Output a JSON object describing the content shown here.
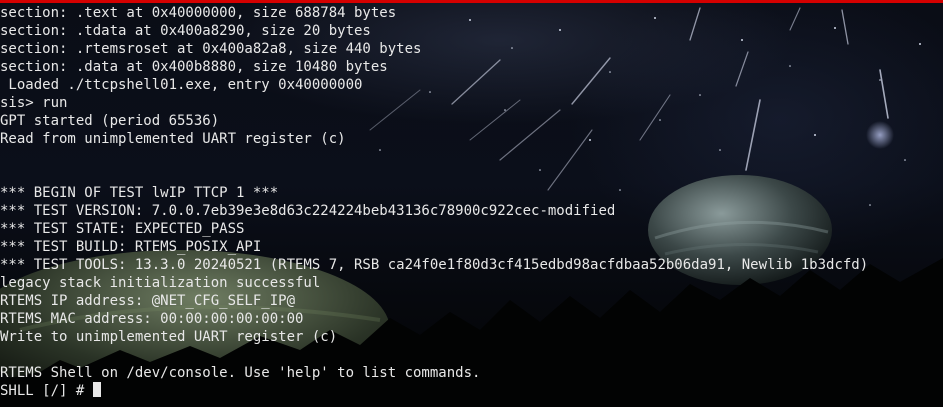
{
  "terminal": {
    "lines": [
      "section: .text at 0x40000000, size 688784 bytes",
      "section: .tdata at 0x400a8290, size 20 bytes",
      "section: .rtemsroset at 0x400a82a8, size 440 bytes",
      "section: .data at 0x400b8880, size 10480 bytes",
      " Loaded ./ttcpshell01.exe, entry 0x40000000",
      "sis> run",
      "GPT started (period 65536)",
      "Read from unimplemented UART register (c)",
      "",
      "",
      "*** BEGIN OF TEST lwIP TTCP 1 ***",
      "*** TEST VERSION: 7.0.0.7eb39e3e8d63c224224beb43136c78900c922cec-modified",
      "*** TEST STATE: EXPECTED_PASS",
      "*** TEST BUILD: RTEMS_POSIX_API",
      "*** TEST TOOLS: 13.3.0 20240521 (RTEMS 7, RSB ca24f0e1f80d3cf415edbd98acfdbaa52b06da91, Newlib 1b3dcfd)",
      "legacy stack initialization successful",
      "RTEMS IP address: @NET_CFG_SELF_IP@",
      "RTEMS MAC address: 00:00:00:00:00:00",
      "Write to unimplemented UART register (c)",
      "",
      "RTEMS Shell on /dev/console. Use 'help' to list commands.",
      "SHLL [/] # "
    ]
  },
  "colors": {
    "text": "#e8e8e8",
    "top_accent": "#d40000",
    "background": "#0b0f1a"
  },
  "icons": {
    "wallpaper": "meteor-shower-space-wallpaper",
    "cursor": "block-cursor"
  }
}
